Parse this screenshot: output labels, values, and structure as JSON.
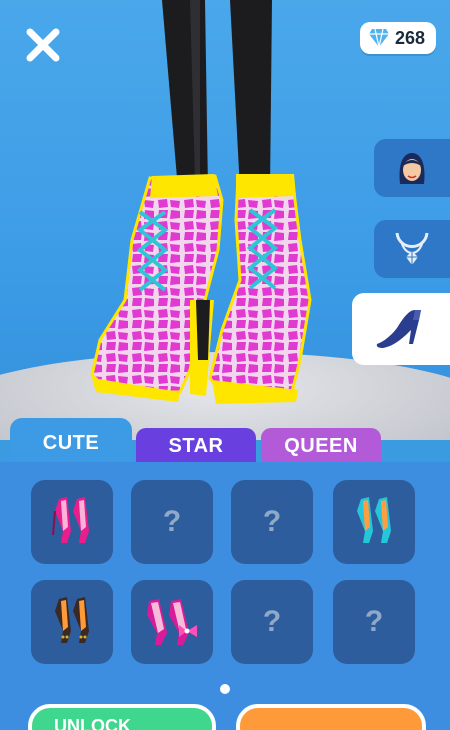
{
  "top_bar": {
    "close_icon": "close-icon",
    "gem_icon": "diamond-icon",
    "gem_count": "268"
  },
  "side_menu": [
    {
      "name": "face",
      "icon": "face-icon"
    },
    {
      "name": "necklace",
      "icon": "necklace-icon"
    },
    {
      "name": "shoe",
      "icon": "high-heel-icon",
      "selected": true
    }
  ],
  "tabs": [
    {
      "label": "CUTE",
      "selected": true
    },
    {
      "label": "STAR"
    },
    {
      "label": "QUEEN"
    }
  ],
  "grid": {
    "unknown_symbol": "?",
    "items": [
      {
        "state": "unlocked",
        "icon": "pink-heels-icon"
      },
      {
        "state": "locked"
      },
      {
        "state": "locked"
      },
      {
        "state": "unlocked",
        "icon": "teal-heels-icon"
      },
      {
        "state": "unlocked",
        "icon": "studded-heels-icon"
      },
      {
        "state": "unlocked",
        "icon": "bow-heels-icon"
      },
      {
        "state": "locked"
      },
      {
        "state": "locked"
      }
    ]
  },
  "bottom": {
    "unlock_label": "UNLOCK"
  },
  "colors": {
    "sky": "#3c9ce6",
    "boot_pink": "#e03ad0",
    "boot_trim": "#ffe600",
    "laces": "#2fc4d6",
    "panel": "#3d8ee0",
    "cell": "#2d5d9c",
    "unlock_green": "#3fd68e",
    "orange": "#ff9a3a"
  }
}
